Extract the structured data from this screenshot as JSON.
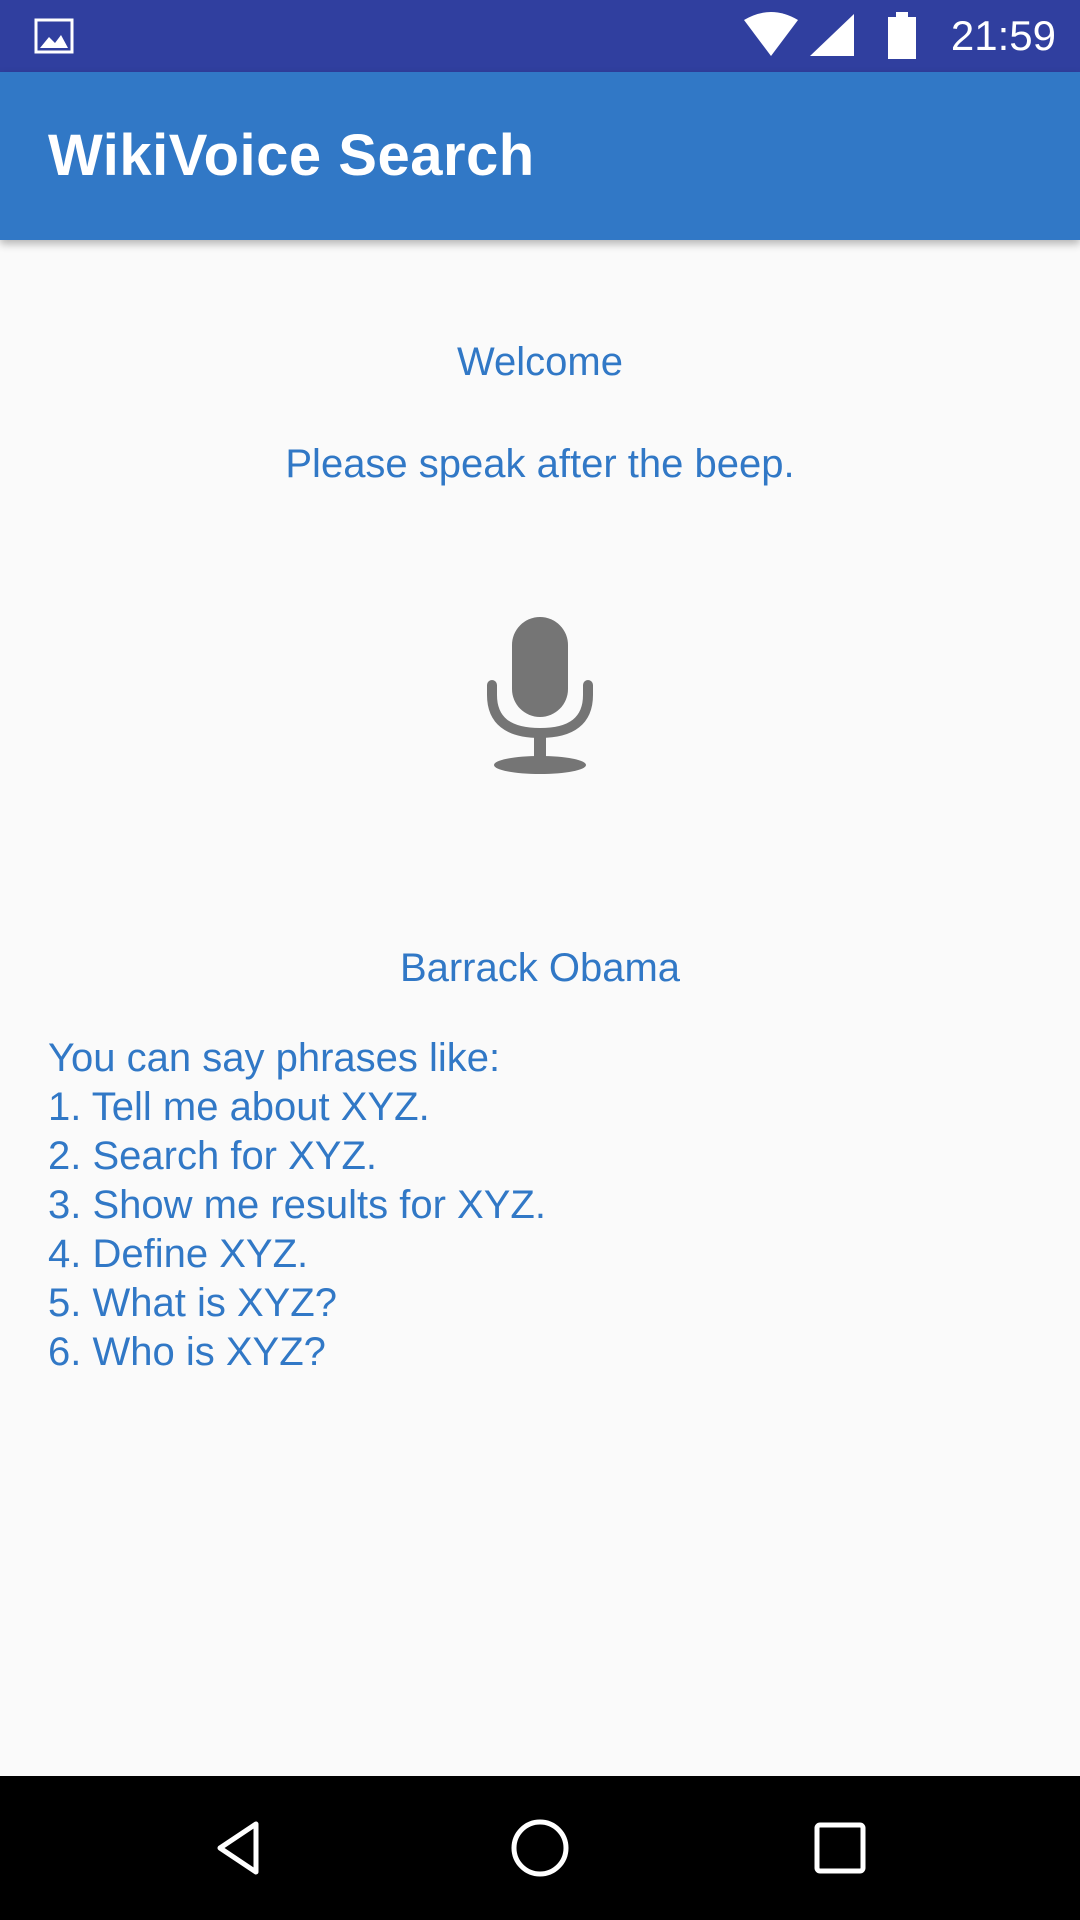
{
  "status_bar": {
    "time": "21:59",
    "icons": [
      "image-notification-icon",
      "wifi-icon",
      "cell-signal-icon",
      "battery-icon"
    ]
  },
  "app_bar": {
    "title": "WikiVoice Search"
  },
  "main": {
    "welcome_text": "Welcome",
    "prompt_text": "Please speak after the beep.",
    "mic_icon": "microphone-icon",
    "recognized_text": "Barrack Obama",
    "phrases": [
      "You can say phrases like:",
      "1. Tell me about XYZ.",
      "2. Search for XYZ.",
      "3. Show me results for XYZ.",
      "4. Define XYZ.",
      "5. What is XYZ?",
      "6. Who is XYZ?"
    ]
  },
  "nav_bar": {
    "icons": [
      "back-icon",
      "home-icon",
      "recents-icon"
    ]
  },
  "colors": {
    "status_bar": "#303f9f",
    "app_bar": "#3178c6",
    "accent_text": "#3178c6",
    "background": "#fafafa",
    "mic_icon": "#757575",
    "nav_bar": "#000000"
  }
}
